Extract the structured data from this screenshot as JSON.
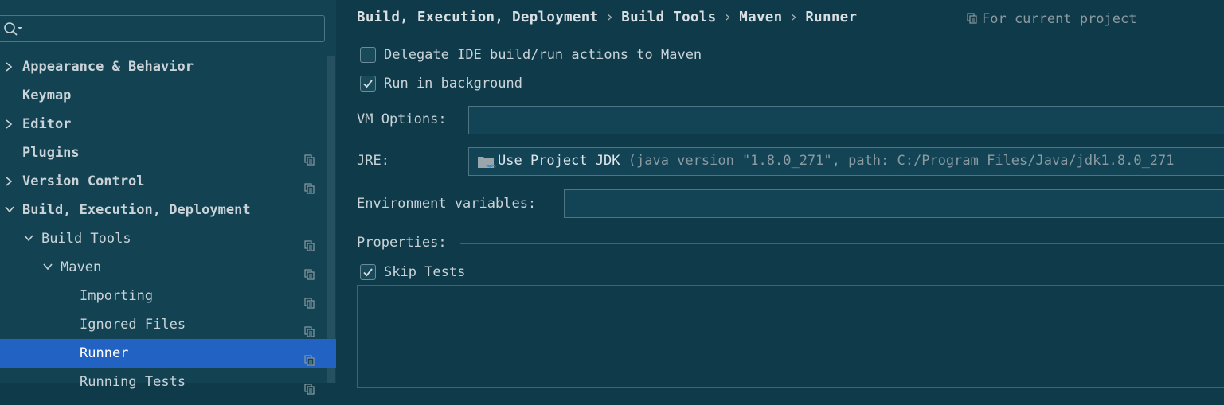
{
  "search": {
    "placeholder": "",
    "value": ""
  },
  "sidebar": {
    "items": [
      {
        "label": "Appearance & Behavior",
        "expandable": true,
        "expanded": false,
        "bold": true,
        "level": 0,
        "project_icon": false
      },
      {
        "label": "Keymap",
        "expandable": false,
        "bold": true,
        "level": 0,
        "project_icon": false
      },
      {
        "label": "Editor",
        "expandable": true,
        "expanded": false,
        "bold": true,
        "level": 0,
        "project_icon": false
      },
      {
        "label": "Plugins",
        "expandable": false,
        "bold": true,
        "level": 0,
        "project_icon": true
      },
      {
        "label": "Version Control",
        "expandable": true,
        "expanded": false,
        "bold": true,
        "level": 0,
        "project_icon": true
      },
      {
        "label": "Build, Execution, Deployment",
        "expandable": true,
        "expanded": true,
        "bold": true,
        "level": 0,
        "project_icon": false
      },
      {
        "label": "Build Tools",
        "expandable": true,
        "expanded": true,
        "bold": false,
        "level": 1,
        "project_icon": true
      },
      {
        "label": "Maven",
        "expandable": true,
        "expanded": true,
        "bold": false,
        "level": 2,
        "project_icon": true
      },
      {
        "label": "Importing",
        "expandable": false,
        "bold": false,
        "level": 3,
        "project_icon": true
      },
      {
        "label": "Ignored Files",
        "expandable": false,
        "bold": false,
        "level": 3,
        "project_icon": true
      },
      {
        "label": "Runner",
        "expandable": false,
        "bold": false,
        "level": 3,
        "project_icon": true,
        "selected": true
      },
      {
        "label": "Running Tests",
        "expandable": false,
        "bold": false,
        "level": 3,
        "project_icon": true
      }
    ]
  },
  "header": {
    "breadcrumb": [
      "Build, Execution, Deployment",
      "Build Tools",
      "Maven",
      "Runner"
    ],
    "separator": "›",
    "scope_label": "For current project"
  },
  "form": {
    "delegate_label": "Delegate IDE build/run actions to Maven",
    "delegate_checked": false,
    "background_label": "Run in background",
    "background_checked": true,
    "vm_options_label": "VM Options:",
    "vm_options_value": "",
    "jre_label": "JRE:",
    "jre_value_main": "Use Project JDK",
    "jre_value_detail": " (java version \"1.8.0_271\", path: C:/Program Files/Java/jdk1.8.0_271",
    "env_label": "Environment variables:",
    "env_value": "",
    "properties_label": "Properties:",
    "skip_tests_label": "Skip Tests",
    "skip_tests_checked": true
  },
  "colors": {
    "background": "#0f3a4a",
    "sidebar": "#134353",
    "selection": "#2162c2",
    "text": "#c9d3d8"
  },
  "icons": {
    "search": "search-icon",
    "chevron_right": "chevron-right-icon",
    "chevron_down": "chevron-down-icon",
    "project_scope": "project-scope-icon",
    "checkmark": "checkmark-icon",
    "jdk_folder": "jdk-folder-icon"
  }
}
